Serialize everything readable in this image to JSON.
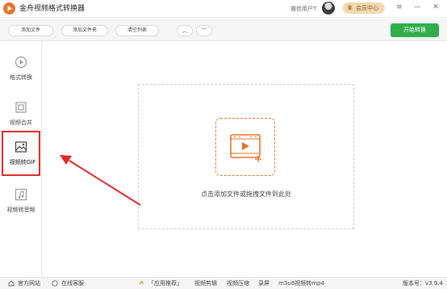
{
  "app": {
    "title": "金舟视频格式转换器",
    "user_name": "微信用户T",
    "vip_label": "会员中心"
  },
  "window_controls": [
    "≡",
    "—",
    "✕"
  ],
  "toolbar": {
    "add_file": "添加文件",
    "add_folder": "添加文件夹",
    "clear_list": "清空列表",
    "move_up": "︿",
    "move_down": "﹀",
    "start": "开始转换"
  },
  "sidebar": {
    "items": [
      {
        "label": "格式转换",
        "icon": "format-convert-icon",
        "active": false
      },
      {
        "label": "视频合并",
        "icon": "merge-icon",
        "active": false
      },
      {
        "label": "视频转GIF",
        "icon": "gif-image-icon",
        "active": true
      },
      {
        "label": "视频转音频",
        "icon": "music-note-icon",
        "active": false
      }
    ]
  },
  "main": {
    "drop_hint": "点击添加文件或拖拽文件到此处"
  },
  "statusbar": {
    "official_site": "官方网站",
    "online_service": "在线客服",
    "recommend": "「应用推荐」",
    "links": [
      "视频剪辑",
      "视频压缩",
      "录屏",
      "m3u8视频转mp4"
    ],
    "version": "版本号：v3.9.4"
  },
  "colors": {
    "accent_orange": "#e8742a",
    "start_green": "#2fae4a",
    "highlight_red": "#e02a2a"
  }
}
